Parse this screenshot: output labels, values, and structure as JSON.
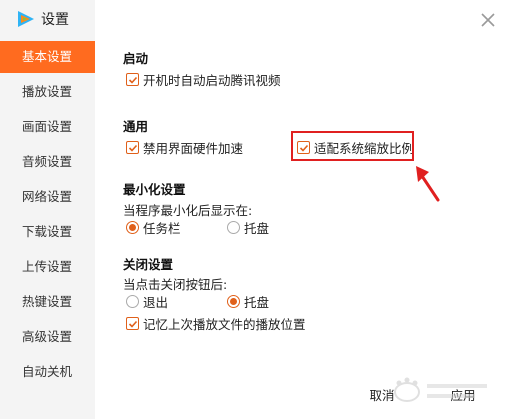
{
  "app": {
    "title": "设置"
  },
  "sidebar": {
    "items": [
      {
        "label": "基本设置",
        "active": true
      },
      {
        "label": "播放设置",
        "active": false
      },
      {
        "label": "画面设置",
        "active": false
      },
      {
        "label": "音频设置",
        "active": false
      },
      {
        "label": "网络设置",
        "active": false
      },
      {
        "label": "下载设置",
        "active": false
      },
      {
        "label": "上传设置",
        "active": false
      },
      {
        "label": "热键设置",
        "active": false
      },
      {
        "label": "高级设置",
        "active": false
      },
      {
        "label": "自动关机",
        "active": false
      }
    ]
  },
  "sections": {
    "startup": {
      "title": "启动",
      "auto_start": {
        "label": "开机时自动启动腾讯视频",
        "checked": true
      }
    },
    "general": {
      "title": "通用",
      "disable_hw": {
        "label": "禁用界面硬件加速",
        "checked": true
      },
      "adapt_scale": {
        "label": "适配系统缩放比例",
        "checked": true
      }
    },
    "minimize": {
      "title": "最小化设置",
      "prompt": "当程序最小化后显示在:",
      "taskbar": {
        "label": "任务栏",
        "selected": true
      },
      "tray": {
        "label": "托盘",
        "selected": false
      }
    },
    "close": {
      "title": "关闭设置",
      "prompt": "当点击关闭按钮后:",
      "exit": {
        "label": "退出",
        "selected": false
      },
      "tray": {
        "label": "托盘",
        "selected": true
      },
      "remember": {
        "label": "记忆上次播放文件的播放位置",
        "checked": true
      }
    }
  },
  "footer": {
    "cancel_label": "取消",
    "apply_label": "应用"
  },
  "colors": {
    "accent": "#ff6b1f",
    "check": "#e0601a",
    "annotation": "#e02020"
  },
  "icons": {
    "logo": "tencent-video-logo-icon",
    "close": "close-icon",
    "check": "checkmark-icon"
  }
}
